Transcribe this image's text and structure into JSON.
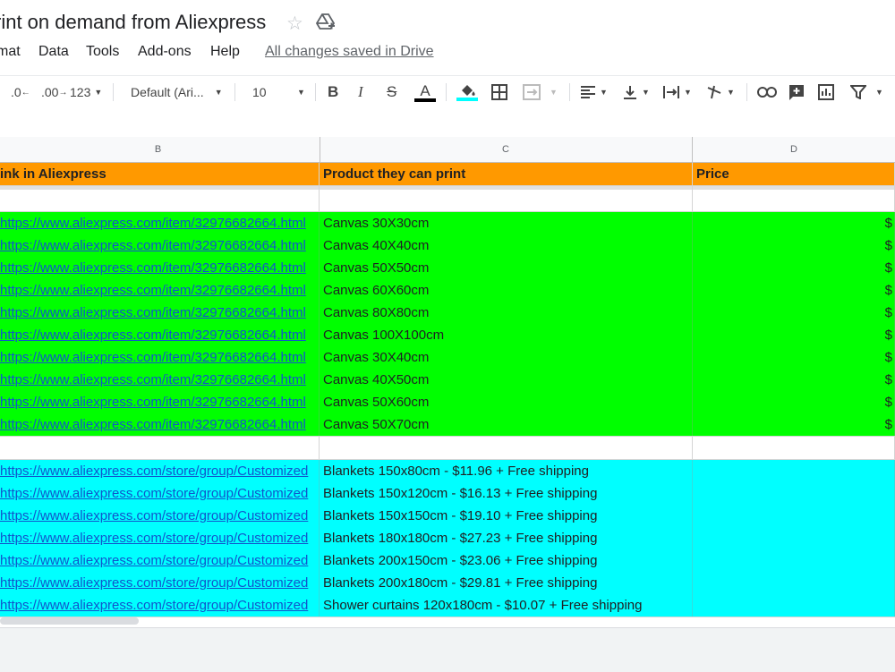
{
  "title": "rint on demand from Aliexpress",
  "menu": [
    "mat",
    "Data",
    "Tools",
    "Add-ons",
    "Help"
  ],
  "saved_status": "All changes saved in Drive",
  "toolbar": {
    "dec_decrease": ".0",
    "dec_increase": ".00",
    "more_formats": "123",
    "font": "Default (Ari...",
    "font_size": "10"
  },
  "columns": [
    "B",
    "C",
    "D"
  ],
  "header_row": {
    "b": "ink in Aliexpress",
    "c": "Product they can print",
    "d": "Price"
  },
  "canvas_rows": [
    {
      "link": "https://www.aliexpress.com/item/32976682664.html",
      "product": "Canvas 30X30cm",
      "price": "$"
    },
    {
      "link": "https://www.aliexpress.com/item/32976682664.html",
      "product": "Canvas 40X40cm",
      "price": "$"
    },
    {
      "link": "https://www.aliexpress.com/item/32976682664.html",
      "product": "Canvas 50X50cm",
      "price": "$"
    },
    {
      "link": "https://www.aliexpress.com/item/32976682664.html",
      "product": "Canvas 60X60cm",
      "price": "$"
    },
    {
      "link": "https://www.aliexpress.com/item/32976682664.html",
      "product": "Canvas 80X80cm",
      "price": "$"
    },
    {
      "link": "https://www.aliexpress.com/item/32976682664.html",
      "product": "Canvas 100X100cm",
      "price": "$"
    },
    {
      "link": "https://www.aliexpress.com/item/32976682664.html",
      "product": "Canvas 30X40cm",
      "price": "$"
    },
    {
      "link": "https://www.aliexpress.com/item/32976682664.html",
      "product": "Canvas 40X50cm",
      "price": "$"
    },
    {
      "link": "https://www.aliexpress.com/item/32976682664.html",
      "product": "Canvas 50X60cm",
      "price": "$"
    },
    {
      "link": "https://www.aliexpress.com/item/32976682664.html",
      "product": "Canvas 50X70cm",
      "price": "$"
    }
  ],
  "blanket_rows": [
    {
      "link": "https://www.aliexpress.com/store/group/Customized",
      "product": "Blankets 150x80cm - $11.96 + Free shipping"
    },
    {
      "link": "https://www.aliexpress.com/store/group/Customized",
      "product": "Blankets 150x120cm - $16.13 + Free shipping"
    },
    {
      "link": "https://www.aliexpress.com/store/group/Customized",
      "product": "Blankets 150x150cm - $19.10 + Free shipping"
    },
    {
      "link": "https://www.aliexpress.com/store/group/Customized",
      "product": "Blankets 180x180cm - $27.23 + Free shipping"
    },
    {
      "link": "https://www.aliexpress.com/store/group/Customized",
      "product": "Blankets 200x150cm - $23.06 + Free shipping"
    },
    {
      "link": "https://www.aliexpress.com/store/group/Customized",
      "product": "Blankets 200x180cm - $29.81 + Free shipping"
    },
    {
      "link": "https://www.aliexpress.com/store/group/Customized",
      "product": "Shower curtains 120x180cm - $10.07 + Free shipping"
    }
  ]
}
